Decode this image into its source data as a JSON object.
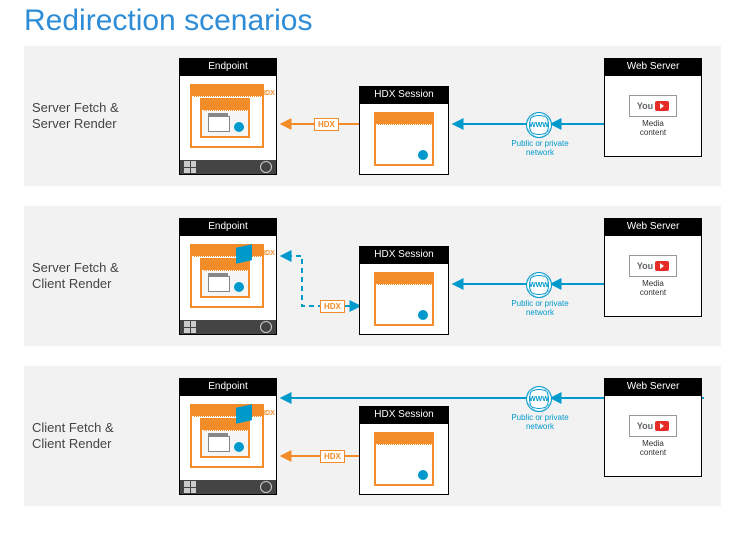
{
  "title": "Redirection scenarios",
  "scenarios": [
    {
      "label1": "Server Fetch &",
      "label2": "Server Render"
    },
    {
      "label1": "Server Fetch &",
      "label2": "Client Render"
    },
    {
      "label1": "Client Fetch &",
      "label2": "Client Render"
    }
  ],
  "endpoint": {
    "header": "Endpoint",
    "caption": "HDX"
  },
  "hdx": {
    "header": "HDX Session"
  },
  "webserver": {
    "header": "Web Server",
    "youtube": "You",
    "media1": "Media",
    "media2": "content"
  },
  "conn": {
    "hdx": "HDX",
    "www": "WWW",
    "net1": "Public or private",
    "net2": "network"
  }
}
